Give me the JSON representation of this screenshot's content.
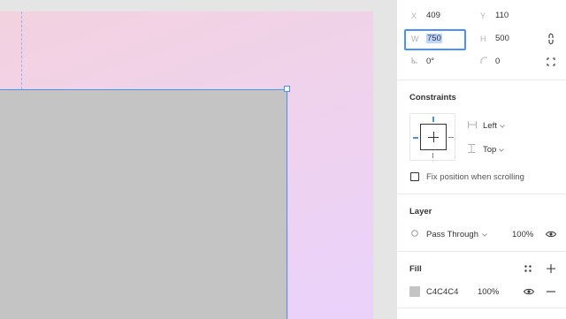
{
  "transform": {
    "x_label": "X",
    "x_value": "409",
    "y_label": "Y",
    "y_value": "110",
    "w_label": "W",
    "w_value": "750",
    "h_label": "H",
    "h_value": "500",
    "rotation_value": "0°",
    "radius_value": "0"
  },
  "constraints": {
    "title": "Constraints",
    "horizontal": "Left",
    "vertical": "Top",
    "fix_position_label": "Fix position when scrolling"
  },
  "layer": {
    "title": "Layer",
    "blend_mode": "Pass Through",
    "opacity": "100%"
  },
  "fill": {
    "title": "Fill",
    "color_hex": "C4C4C4",
    "opacity": "100%",
    "swatch_color": "#C4C4C4"
  },
  "colors": {
    "accent": "#4A90FF",
    "rect_fill": "#C4C4C4",
    "frame_gradient_start": "#F3D2DF",
    "frame_gradient_end": "#EAD2FB"
  }
}
